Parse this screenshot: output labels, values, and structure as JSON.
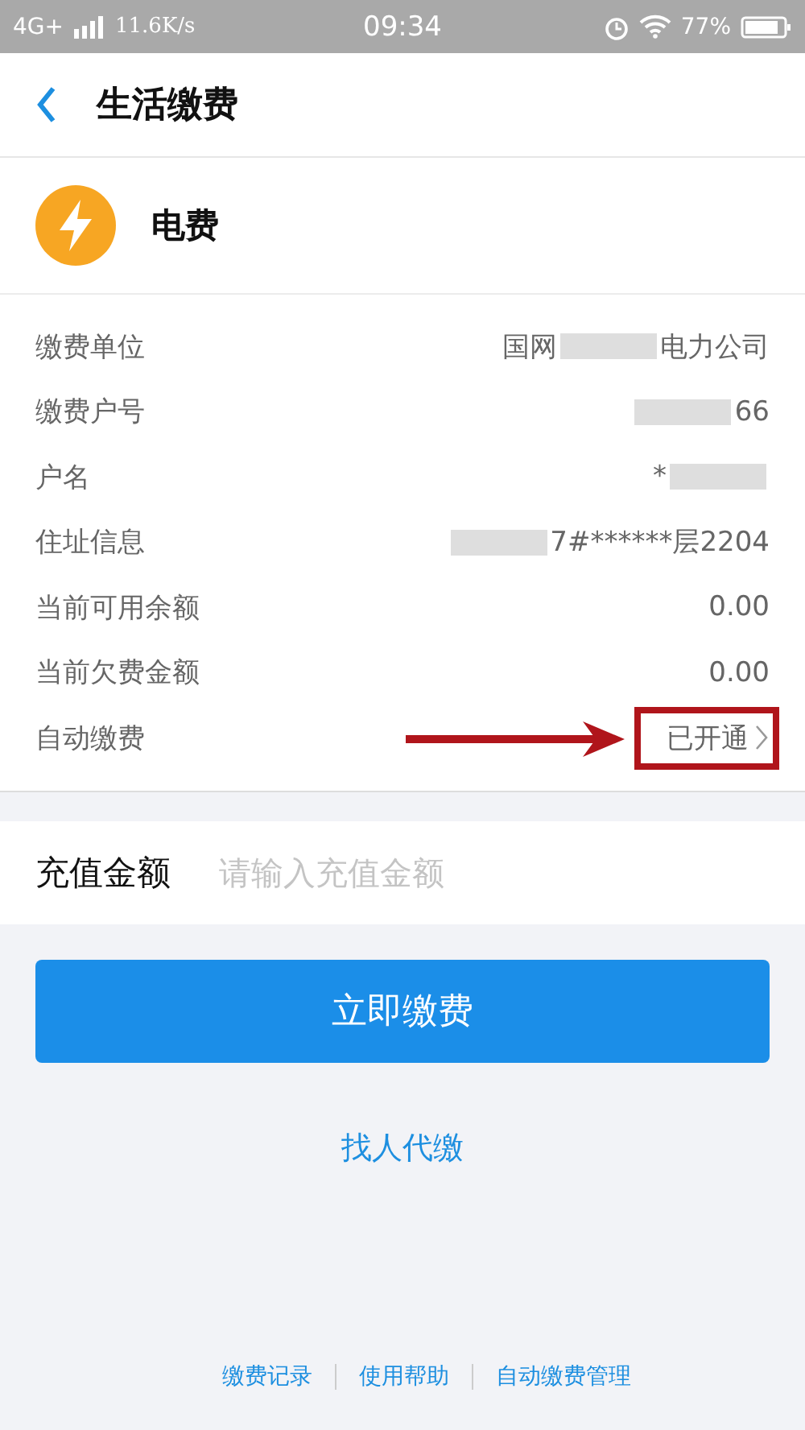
{
  "status_bar": {
    "network": "4G+",
    "speed": "11.6K/s",
    "time": "09:34",
    "battery": "77%"
  },
  "header": {
    "title": "生活缴费"
  },
  "service": {
    "name": "电费"
  },
  "rows": [
    {
      "kind": "redacted",
      "label": "缴费单位",
      "value_start": "国网",
      "value_end": "电力公司"
    },
    {
      "kind": "redacted",
      "label": "缴费户号",
      "value_end": "66"
    },
    {
      "kind": "redacted",
      "label": "户名",
      "value_start": "*"
    },
    {
      "kind": "redacted",
      "label": "住址信息",
      "value_end": "7#******层2204"
    },
    {
      "kind": "plain",
      "label": "当前可用余额",
      "value_end": "0.00"
    },
    {
      "kind": "plain",
      "label": "当前欠费金额",
      "value_end": "0.00"
    },
    {
      "kind": "link",
      "label": "自动缴费",
      "value_end": "已开通",
      "highlighted": true
    }
  ],
  "amount": {
    "label": "充值金额",
    "placeholder": "请输入充值金额"
  },
  "pay_button": "立即缴费",
  "proxy_link": "找人代缴",
  "footer_links": [
    "缴费记录",
    "使用帮助",
    "自动缴费管理"
  ]
}
